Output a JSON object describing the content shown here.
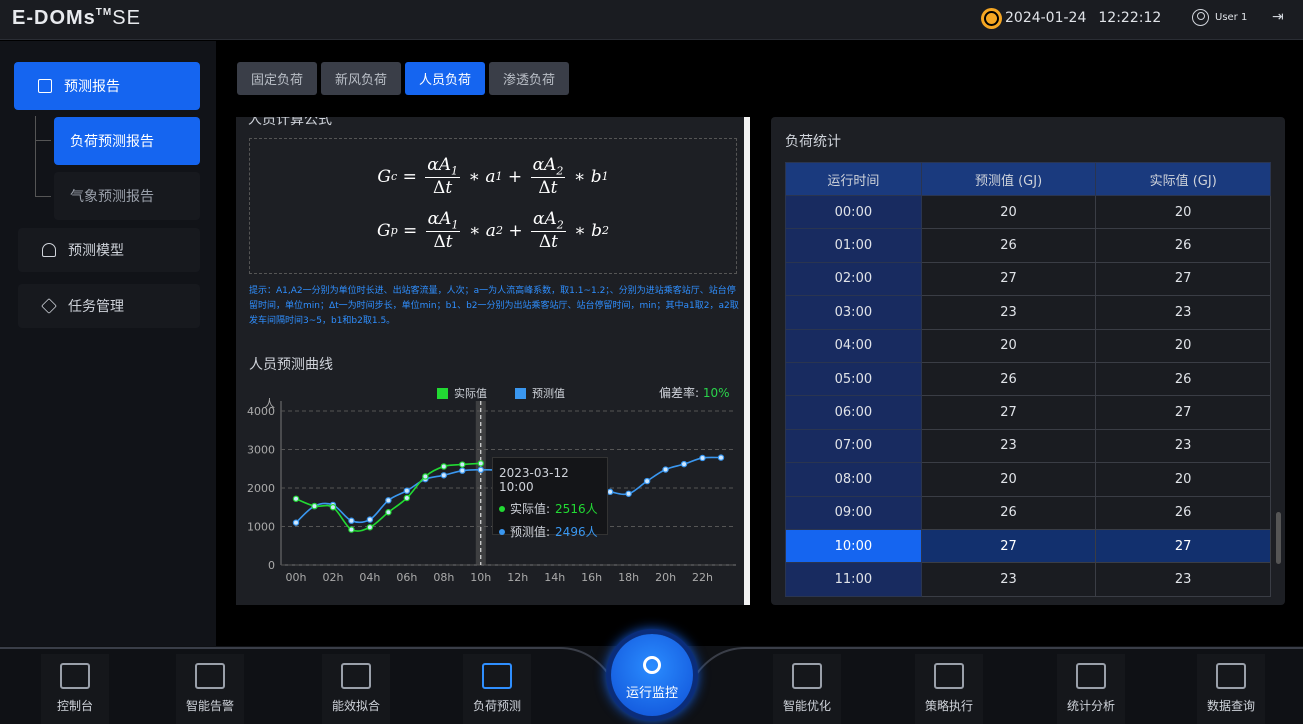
{
  "header": {
    "logo_main": "E-DOMs",
    "logo_tm": "TM",
    "logo_suffix": "SE",
    "date": "2024-01-24",
    "time": "12:22:12",
    "user": "User 1"
  },
  "sidebar": {
    "items": [
      {
        "label": "预测报告"
      },
      {
        "label": "负荷预测报告"
      },
      {
        "label": "气象预测报告"
      },
      {
        "label": "预测模型"
      },
      {
        "label": "任务管理"
      }
    ]
  },
  "tabs": [
    "固定负荷",
    "新风负荷",
    "人员负荷",
    "渗透负荷"
  ],
  "formula": {
    "title": "人员计算公式",
    "tip": "提示：A1,A2一分别为单位时长进、出站客流量，人次；a一为人流高峰系数，取1.1~1.2；、分别为进站乘客站厅、站台停留时间，单位min；Δt一为时间步长，单位min；b1、b2一分别为出站乘客站厅、站台停留时间，min；其中a1取2，a2取发车间隔时间3~5，b1和b2取1.5。"
  },
  "curve": {
    "title": "人员预测曲线",
    "y_unit": "人",
    "legend_actual": "实际值",
    "legend_pred": "预测值",
    "deviation_label": "偏差率:",
    "deviation_value": "10%",
    "tooltip": {
      "time": "2023-03-12 10:00",
      "actual_label": "实际值:",
      "actual_value": "2516人",
      "pred_label": "预测值:",
      "pred_value": "2496人"
    }
  },
  "colors": {
    "actual": "#22d933",
    "pred": "#3a97f0",
    "accent": "#1565f0"
  },
  "chart_data": {
    "type": "line",
    "ylabel": "人",
    "ylim": [
      0,
      4000
    ],
    "yticks": [
      0,
      1000,
      2000,
      3000,
      4000
    ],
    "xticks": [
      "00h",
      "02h",
      "04h",
      "06h",
      "08h",
      "10h",
      "12h",
      "14h",
      "16h",
      "18h",
      "20h",
      "22h"
    ],
    "series": [
      {
        "name": "实际值",
        "x": [
          0,
          1,
          2,
          3,
          4,
          5,
          6,
          7,
          8,
          9,
          10
        ],
        "values": [
          1720,
          1530,
          1500,
          920,
          980,
          1370,
          1740,
          2300,
          2560,
          2610,
          2640
        ]
      },
      {
        "name": "预测值",
        "x": [
          0,
          1,
          2,
          3,
          4,
          5,
          6,
          7,
          8,
          9,
          10,
          11,
          12,
          13,
          14,
          15,
          16,
          17,
          18,
          19,
          20,
          21,
          22,
          23
        ],
        "values": [
          1100,
          1530,
          1560,
          1150,
          1180,
          1680,
          1930,
          2230,
          2330,
          2450,
          2470,
          2420,
          2000,
          1950,
          1950,
          2000,
          1980,
          1900,
          1850,
          2180,
          2480,
          2620,
          2780,
          2790
        ]
      }
    ],
    "highlight_x": 10
  },
  "stats": {
    "title": "负荷统计",
    "columns": [
      "运行时间",
      "预测值 (GJ)",
      "实际值 (GJ)"
    ],
    "rows": [
      [
        "00:00",
        "20",
        "20"
      ],
      [
        "01:00",
        "26",
        "26"
      ],
      [
        "02:00",
        "27",
        "27"
      ],
      [
        "03:00",
        "23",
        "23"
      ],
      [
        "04:00",
        "20",
        "20"
      ],
      [
        "05:00",
        "26",
        "26"
      ],
      [
        "06:00",
        "27",
        "27"
      ],
      [
        "07:00",
        "23",
        "23"
      ],
      [
        "08:00",
        "20",
        "20"
      ],
      [
        "09:00",
        "26",
        "26"
      ],
      [
        "10:00",
        "27",
        "27"
      ],
      [
        "11:00",
        "23",
        "23"
      ]
    ],
    "selected_row": 10
  },
  "bottom_nav": [
    {
      "label": "控制台",
      "icon": "monitor-icon"
    },
    {
      "label": "智能告警",
      "icon": "alarm-icon"
    },
    {
      "label": "能效拟合",
      "icon": "cube-icon"
    },
    {
      "label": "负荷预测",
      "icon": "trend-icon"
    },
    {
      "label": "运行监控",
      "icon": "camera-icon"
    },
    {
      "label": "智能优化",
      "icon": "sliders-icon"
    },
    {
      "label": "策略执行",
      "icon": "checklist-icon"
    },
    {
      "label": "统计分析",
      "icon": "bar-chart-icon"
    },
    {
      "label": "数据查询",
      "icon": "search-doc-icon"
    }
  ]
}
